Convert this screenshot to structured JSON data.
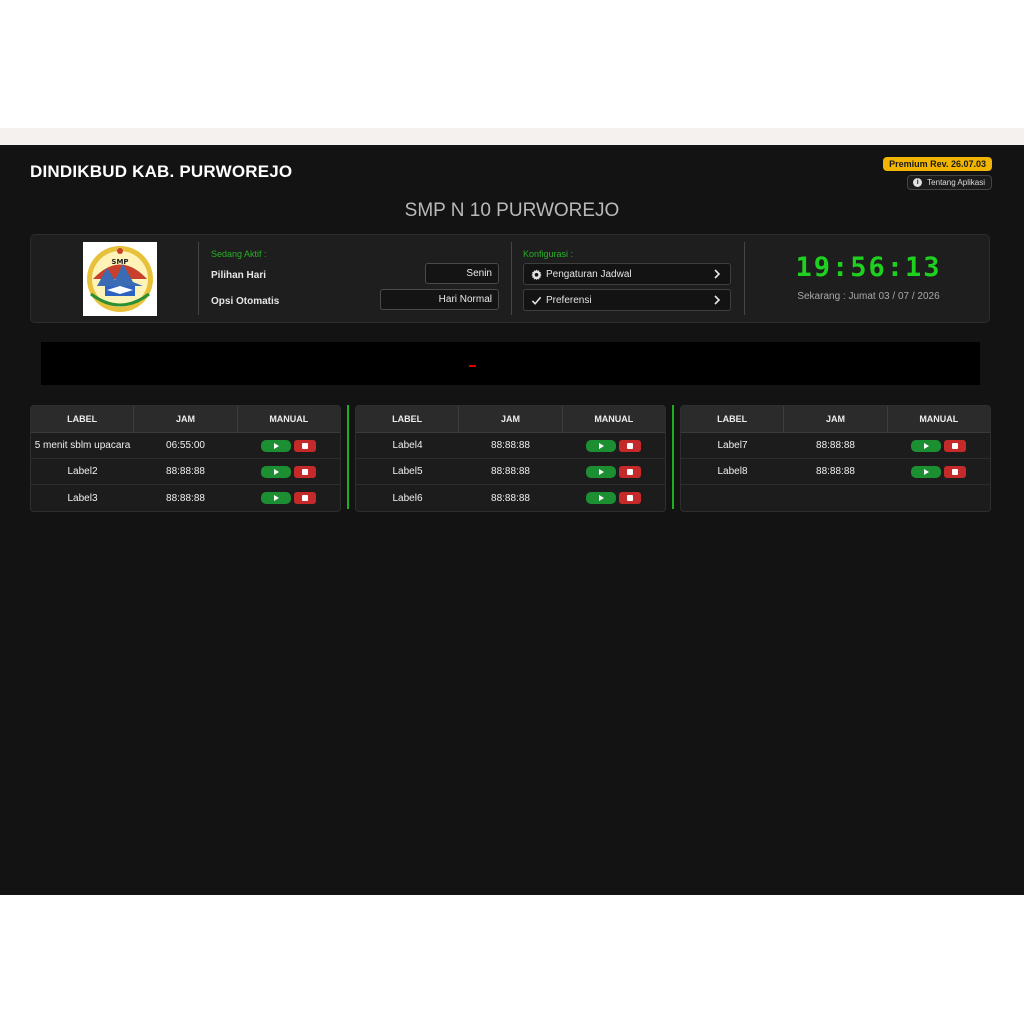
{
  "header": {
    "org_title": "DINDIKBUD KAB. PURWOREJO",
    "premium_badge": "Premium Rev. 26.07.03",
    "about_label": "Tentang Aplikasi",
    "school_title": "SMP N 10 PURWOREJO"
  },
  "status": {
    "section_title": "Sedang Aktif :",
    "day_label": "Pilihan Hari",
    "day_value": "Senin",
    "auto_label": "Opsi Otomatis",
    "auto_value": "Hari Normal"
  },
  "config": {
    "section_title": "Konfigurasi :",
    "schedule_label": "Pengaturan Jadwal",
    "prefs_label": "Preferensi"
  },
  "clock": {
    "time": "19:56:13",
    "date_line": "Sekarang : Jumat 03 / 07 / 2026"
  },
  "logo": {
    "text": "SMP"
  },
  "tables": [
    {
      "headers": [
        "LABEL",
        "JAM",
        "MANUAL"
      ],
      "rows": [
        {
          "label": "5 menit sblm upacara",
          "jam": "06:55:00"
        },
        {
          "label": "Label2",
          "jam": "88:88:88"
        },
        {
          "label": "Label3",
          "jam": "88:88:88"
        }
      ]
    },
    {
      "headers": [
        "LABEL",
        "JAM",
        "MANUAL"
      ],
      "rows": [
        {
          "label": "Label4",
          "jam": "88:88:88"
        },
        {
          "label": "Label5",
          "jam": "88:88:88"
        },
        {
          "label": "Label6",
          "jam": "88:88:88"
        }
      ]
    },
    {
      "headers": [
        "LABEL",
        "JAM",
        "MANUAL"
      ],
      "rows": [
        {
          "label": "Label7",
          "jam": "88:88:88"
        },
        {
          "label": "Label8",
          "jam": "88:88:88"
        }
      ]
    }
  ],
  "colors": {
    "accent_green": "#1fd11f",
    "premium_yellow": "#f1b400",
    "play_green": "#1d8f33",
    "stop_red": "#c42a2a"
  }
}
